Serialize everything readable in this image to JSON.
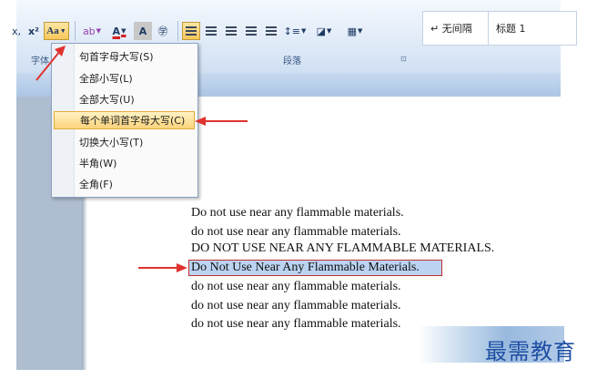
{
  "ribbon": {
    "font_group_label": "字体",
    "paragraph_group_label": "段落",
    "change_case_button": "Aa",
    "superscript_label": "x²",
    "subscript_label": "x,",
    "font_color_label": "A",
    "char_shading_label": "A",
    "enclose_char_label": "㊫",
    "styles": [
      "↵ 无间隔",
      "标题 1"
    ]
  },
  "change_case_menu": {
    "items": [
      {
        "label": "句首字母大写(S)",
        "highlighted": false
      },
      {
        "label": "全部小写(L)",
        "highlighted": false
      },
      {
        "label": "全部大写(U)",
        "highlighted": false
      },
      {
        "label": "每个单词首字母大写(C)",
        "highlighted": true
      },
      {
        "label": "切换大小写(T)",
        "highlighted": false
      },
      {
        "label": "半角(W)",
        "highlighted": false
      },
      {
        "label": "全角(F)",
        "highlighted": false
      }
    ]
  },
  "document": {
    "lines": [
      "Do not use near any flammable materials.",
      "do not use near any flammable materials.",
      "DO NOT USE NEAR ANY FLAMMABLE MATERIALS.",
      "Do Not Use Near Any Flammable Materials.",
      "do not use near any flammable materials.",
      "do not use near any flammable materials.",
      "do not use near any flammable materials."
    ],
    "selected_index": 3
  },
  "watermark": {
    "text": "最需教育"
  },
  "colors": {
    "arrow": "#e0322e",
    "highlight": "#fcd37a",
    "selection": "#bcd3f2"
  }
}
